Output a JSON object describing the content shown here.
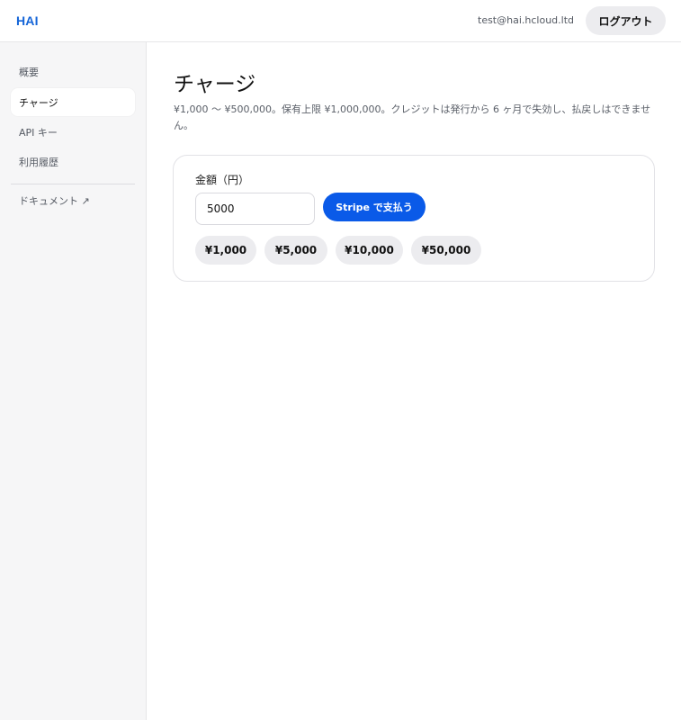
{
  "header": {
    "logo": "HAI",
    "user_email": "test@hai.hcloud.ltd",
    "logout_label": "ログアウト"
  },
  "sidebar": {
    "items": [
      {
        "label": "概要",
        "active": false
      },
      {
        "label": "チャージ",
        "active": true
      },
      {
        "label": "API キー",
        "active": false
      },
      {
        "label": "利用履歴",
        "active": false
      }
    ],
    "docs_label": "ドキュメント ↗"
  },
  "main": {
    "title": "チャージ",
    "description": "¥1,000 〜 ¥500,000。保有上限 ¥1,000,000。クレジットは発行から 6 ヶ月で失効し、払戻しはできません。",
    "card": {
      "amount_label": "金額（円）",
      "amount_value": "5000",
      "pay_label": "Stripe で支払う",
      "presets": [
        "¥1,000",
        "¥5,000",
        "¥10,000",
        "¥50,000"
      ]
    }
  },
  "colors": {
    "accent": "#0a5ae8",
    "logo": "#1565d8",
    "sidebar_bg": "#f6f6f7",
    "pill_bg": "#ececef"
  }
}
